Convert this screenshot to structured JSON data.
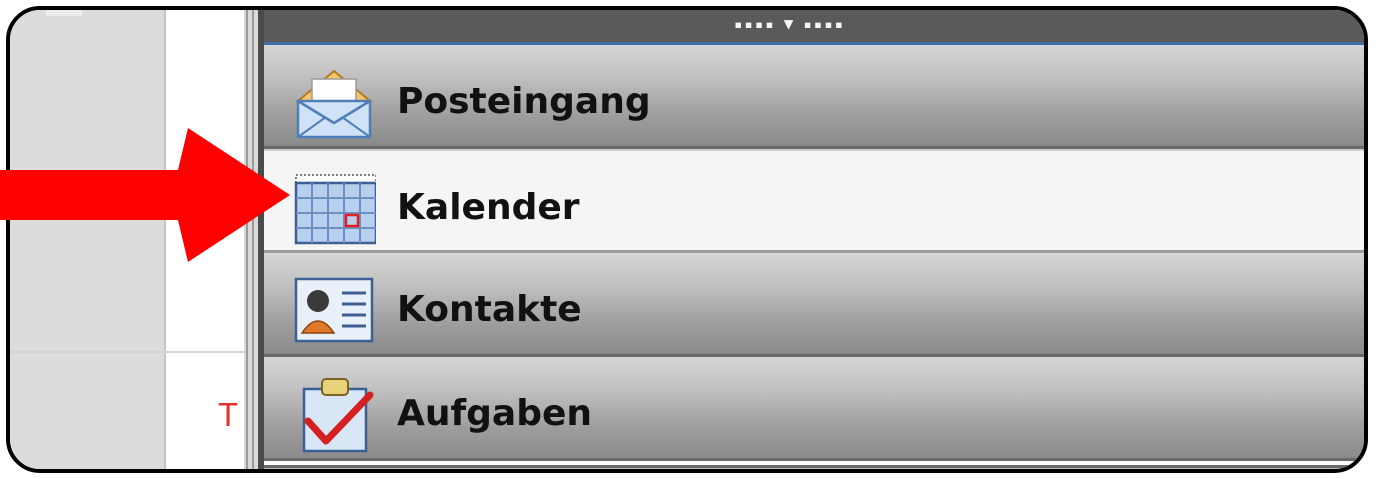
{
  "nav": {
    "items": [
      {
        "label": "Posteingang",
        "icon": "mail-inbox-icon",
        "selected": false
      },
      {
        "label": "Kalender",
        "icon": "calendar-icon",
        "selected": true
      },
      {
        "label": "Kontakte",
        "icon": "contacts-card-icon",
        "selected": false
      },
      {
        "label": "Aufgaben",
        "icon": "tasks-clipboard-icon",
        "selected": false
      }
    ]
  },
  "left_panel": {
    "partial_text": "T"
  },
  "grip": {
    "left_dots": "▪▪▪▪",
    "arrow": "▼",
    "right_dots": "▪▪▪▪"
  },
  "annotation": {
    "arrow_color": "#ff0000",
    "arrow_icon": "pointing-arrow-icon"
  },
  "colors": {
    "accent": "#3c6ea8",
    "nav_bg": "#a8a8a8",
    "selected_bg": "#f5f5f5"
  }
}
